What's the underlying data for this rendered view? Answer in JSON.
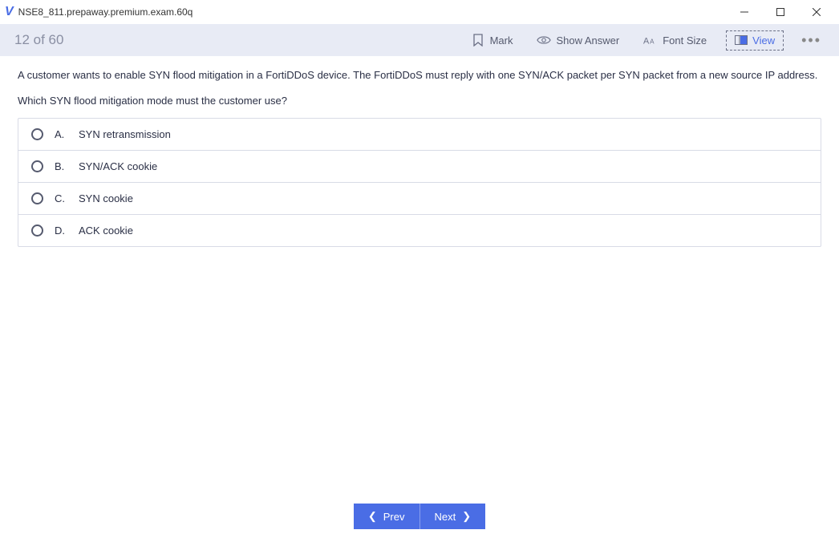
{
  "window": {
    "title": "NSE8_811.prepaway.premium.exam.60q"
  },
  "toolbar": {
    "counter": "12 of 60",
    "mark": "Mark",
    "show_answer": "Show Answer",
    "font_size": "Font Size",
    "view": "View"
  },
  "question": {
    "stem1": "A customer wants to enable SYN flood mitigation in a FortiDDoS device. The FortiDDoS must reply with one SYN/ACK packet per SYN packet from a new source IP address.",
    "stem2": "Which SYN flood mitigation mode must the customer use?"
  },
  "options": [
    {
      "letter": "A.",
      "text": "SYN retransmission"
    },
    {
      "letter": "B.",
      "text": "SYN/ACK cookie"
    },
    {
      "letter": "C.",
      "text": "SYN cookie"
    },
    {
      "letter": "D.",
      "text": "ACK cookie"
    }
  ],
  "nav": {
    "prev": "Prev",
    "next": "Next"
  }
}
